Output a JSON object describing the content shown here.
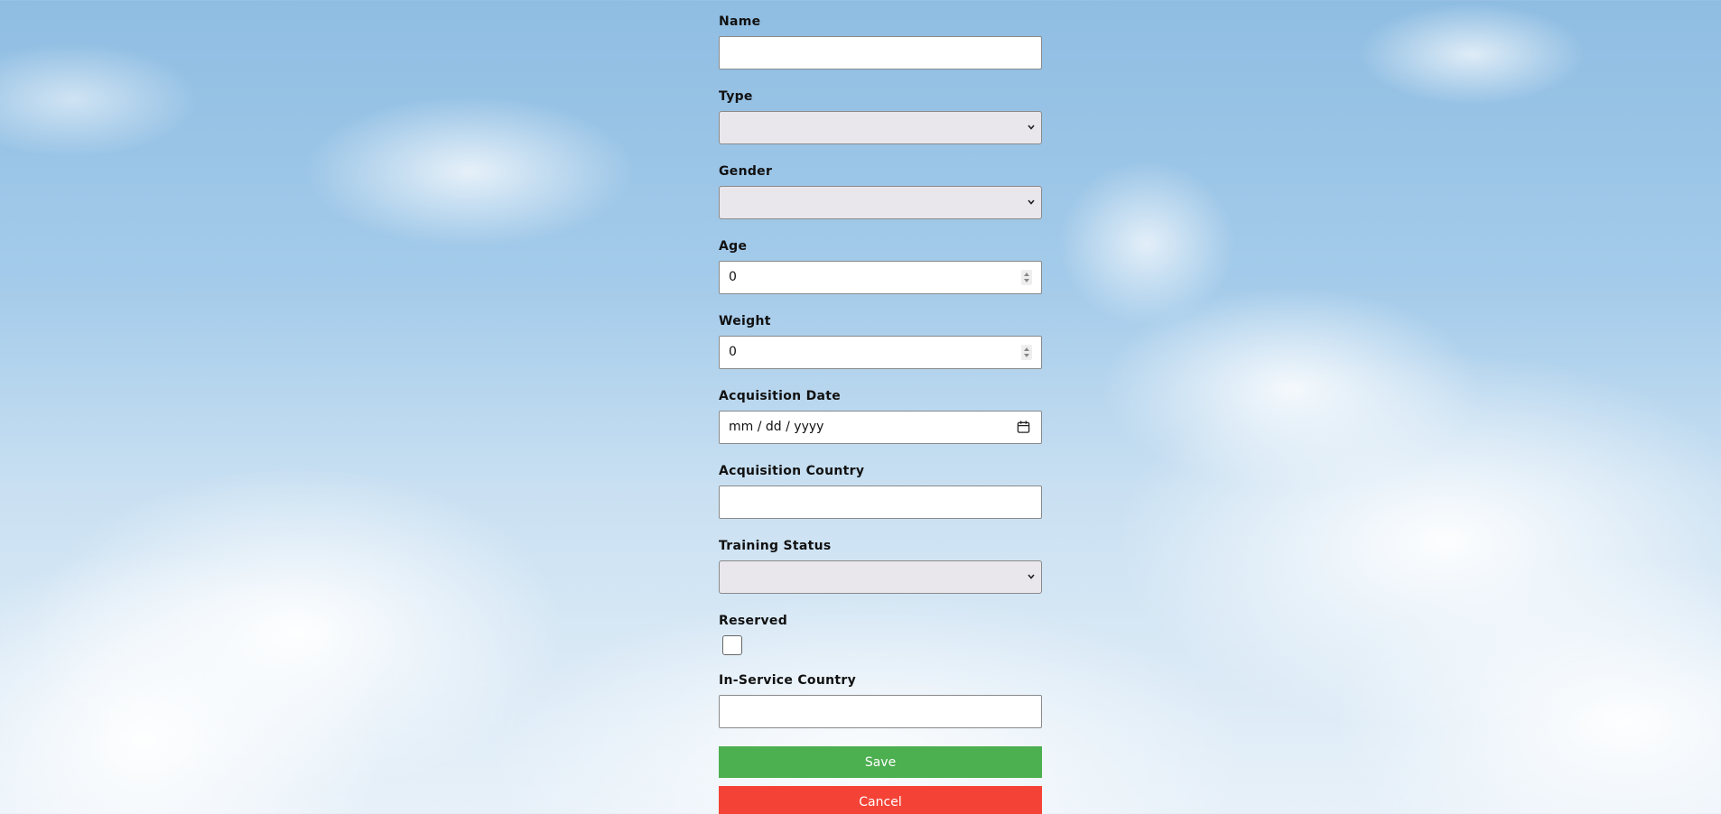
{
  "form": {
    "fields": {
      "name": {
        "label": "Name",
        "value": ""
      },
      "type": {
        "label": "Type",
        "selected": ""
      },
      "gender": {
        "label": "Gender",
        "selected": ""
      },
      "age": {
        "label": "Age",
        "value": "0"
      },
      "weight": {
        "label": "Weight",
        "value": "0"
      },
      "acquisition_date": {
        "label": "Acquisition Date",
        "placeholder": "mm / dd / yyyy"
      },
      "acquisition_country": {
        "label": "Acquisition Country",
        "value": ""
      },
      "training_status": {
        "label": "Training Status",
        "selected": ""
      },
      "reserved": {
        "label": "Reserved",
        "checked": false
      },
      "in_service_country": {
        "label": "In-Service Country",
        "value": ""
      }
    },
    "buttons": {
      "save_label": "Save",
      "cancel_label": "Cancel"
    }
  },
  "icons": {
    "dropdown": "chevron-down-icon",
    "spinner": "spinner-icon",
    "calendar": "calendar-icon"
  },
  "colors": {
    "save": "#4caf50",
    "cancel": "#f44336",
    "select_bg": "#e9e7ec"
  }
}
